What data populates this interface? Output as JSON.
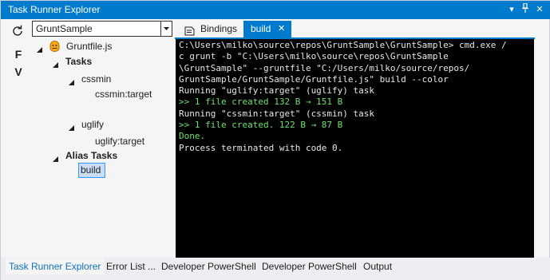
{
  "window": {
    "title": "Task Runner Explorer",
    "controls": {
      "dropdown_glyph": "▾",
      "pin_glyph": "⊥",
      "close_glyph": "✕"
    }
  },
  "toolbar": {
    "refresh_icon": "refresh-icon",
    "letters": [
      "F",
      "V"
    ]
  },
  "project_select": {
    "value": "GruntSample"
  },
  "tree": {
    "root_label": "Gruntfile.js",
    "tasks_label": "Tasks",
    "cssmin_label": "cssmin",
    "cssmin_target_label": "cssmin:target",
    "uglify_label": "uglify",
    "uglify_target_label": "uglify:target",
    "alias_tasks_label": "Alias Tasks",
    "build_label": "build"
  },
  "tabs": {
    "bindings_label": "Bindings",
    "build_label": "build",
    "build_close_glyph": "✕"
  },
  "console": {
    "lines": [
      {
        "text": "C:\\Users\\milko\\source\\repos\\GruntSample\\GruntSample> cmd.exe /",
        "color": "#e8e8e8"
      },
      {
        "text": "c grunt -b \"C:\\Users\\milko\\source\\repos\\GruntSample",
        "color": "#e8e8e8"
      },
      {
        "text": "\\GruntSample\" --gruntfile \"C:/Users/milko/source/repos/",
        "color": "#e8e8e8"
      },
      {
        "text": "GruntSample/GruntSample/Gruntfile.js\" build --color",
        "color": "#e8e8e8"
      },
      {
        "text": "Running \"uglify:target\" (uglify) task",
        "color": "#e8e8e8"
      },
      {
        "text": ">> 1 file created 132 B → 151 B",
        "color": "#6fe06f"
      },
      {
        "text": "Running \"cssmin:target\" (cssmin) task",
        "color": "#e8e8e8"
      },
      {
        "text": ">> 1 file created. 122 B → 87 B",
        "color": "#6fe06f"
      },
      {
        "text": "Done.",
        "color": "#6fe06f"
      },
      {
        "text": "Process terminated with code 0.",
        "color": "#e8e8e8"
      }
    ]
  },
  "bottom_tabs": [
    {
      "label": "Task Runner Explorer",
      "active": true
    },
    {
      "label": "Error List ...",
      "active": false
    },
    {
      "label": "Developer PowerShell",
      "active": false
    },
    {
      "label": "Developer PowerShell",
      "active": false
    },
    {
      "label": "Output",
      "active": false
    }
  ],
  "colors": {
    "accent": "#007acc",
    "console_bg": "#000000",
    "console_text": "#e8e8e8",
    "console_success": "#6fe06f",
    "selection_bg": "#c9def5",
    "selection_border": "#3399ff"
  }
}
